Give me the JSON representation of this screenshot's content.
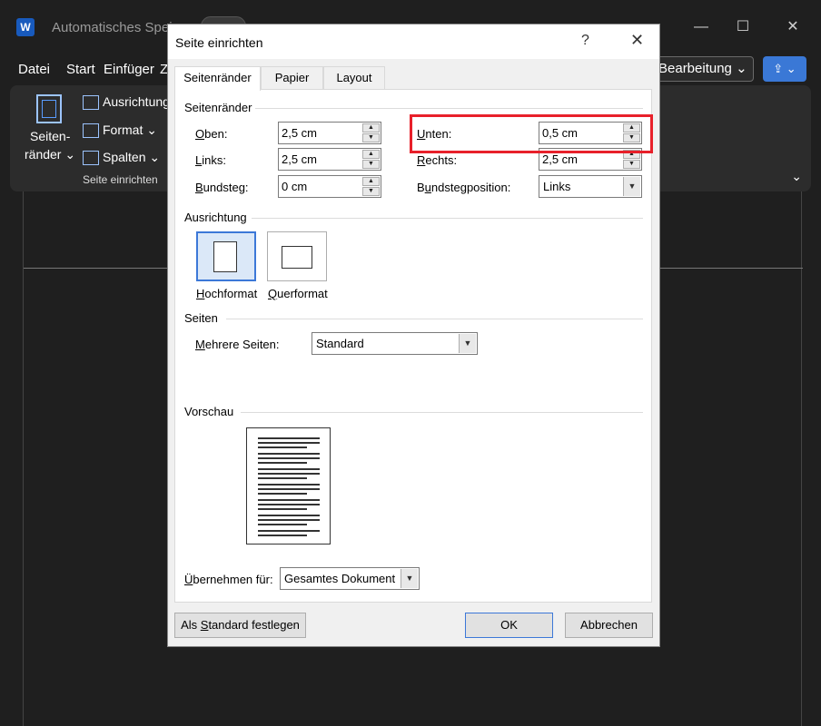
{
  "word": {
    "logo": "W",
    "title": "Automatisches Speic",
    "menu": [
      "Datei",
      "Start",
      "Einfüger",
      "Z"
    ],
    "edit_label": "Bearbeitung ⌄",
    "share_label": "⇪ ⌄",
    "ribbon": {
      "margins_label_1": "Seiten-",
      "margins_label_2": "ränder ⌄",
      "orientation": "Ausrichtung",
      "format": "Format ⌄",
      "columns": "Spalten ⌄",
      "group_label": "Seite einrichten",
      "collapse": "⌄"
    },
    "window_controls": {
      "minimize": "—",
      "maximize": "☐",
      "close": "✕"
    }
  },
  "dialog": {
    "title": "Seite einrichten",
    "help": "?",
    "close": "✕",
    "tabs": [
      {
        "label": "Seitenränder",
        "active": true
      },
      {
        "label": "Papier",
        "active": false
      },
      {
        "label": "Layout",
        "active": false
      }
    ],
    "margins_section": "Seitenränder",
    "fields": {
      "oben": {
        "label_u": "O",
        "label_rest": "ben:",
        "value": "2,5 cm"
      },
      "links": {
        "label_u": "L",
        "label_rest": "inks:",
        "value": "2,5 cm"
      },
      "bundsteg": {
        "label_u": "B",
        "label_rest": "undsteg:",
        "value": "0 cm"
      },
      "unten": {
        "label_u": "U",
        "label_rest": "nten:",
        "value": "0,5 cm"
      },
      "rechts": {
        "label_u": "R",
        "label_rest": "echts:",
        "value": "2,5 cm"
      },
      "bundstegposition": {
        "label_pre": "B",
        "label_u": "u",
        "label_rest": "ndstegposition:",
        "value": "Links"
      }
    },
    "orientation_section": "Ausrichtung",
    "orientation": {
      "portrait_u": "H",
      "portrait_rest": "ochformat",
      "landscape_u": "Q",
      "landscape_rest": "uerformat",
      "selected": "portrait"
    },
    "pages_section": "Seiten",
    "multiple_pages": {
      "label_u": "M",
      "label_rest": "ehrere Seiten:",
      "value": "Standard"
    },
    "preview_section": "Vorschau",
    "apply_to": {
      "label_u": "Ü",
      "label_rest": "bernehmen für:",
      "value": "Gesamtes Dokument"
    },
    "buttons": {
      "default_pre": "Als ",
      "default_u": "S",
      "default_rest": "tandard festlegen",
      "ok": "OK",
      "cancel": "Abbrechen"
    }
  }
}
